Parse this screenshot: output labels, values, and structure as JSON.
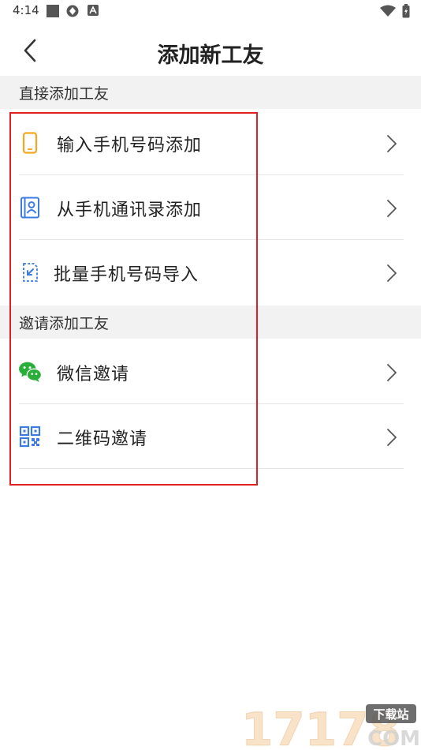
{
  "status": {
    "time": "4:14"
  },
  "header": {
    "title": "添加新工友"
  },
  "sections": [
    {
      "title": "直接添加工友",
      "items": [
        {
          "label": "输入手机号码添加",
          "icon": "phone-icon"
        },
        {
          "label": "从手机通讯录添加",
          "icon": "contacts-book-icon"
        },
        {
          "label": "批量手机号码导入",
          "icon": "import-file-icon"
        }
      ]
    },
    {
      "title": "邀请添加工友",
      "items": [
        {
          "label": "微信邀请",
          "icon": "wechat-icon"
        },
        {
          "label": "二维码邀请",
          "icon": "qr-code-icon"
        }
      ]
    }
  ],
  "colors": {
    "phone_icon": "#f5a623",
    "blue_icon": "#3d7be0",
    "wechat_green": "#2aae3a",
    "highlight": "#e02020",
    "section_bg": "#f2f2f2"
  },
  "watermark": {
    "number": "17178",
    "badge": "下载站",
    "suffix": "COM"
  }
}
